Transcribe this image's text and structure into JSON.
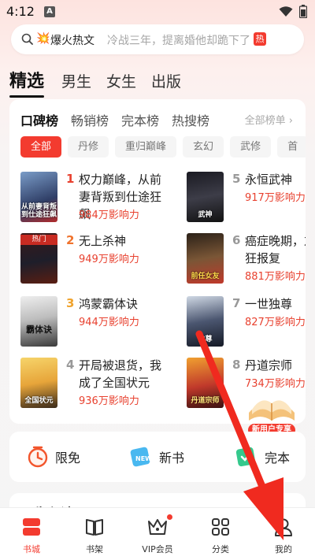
{
  "status": {
    "time": "4:12",
    "indicator": "A"
  },
  "search": {
    "hot_label": "爆火热文",
    "placeholder_text": "冷战三年，提离婚他却跪下了",
    "hot_badge": "热"
  },
  "top_tabs": [
    {
      "label": "精选",
      "active": true
    },
    {
      "label": "男生",
      "active": false
    },
    {
      "label": "女生",
      "active": false
    },
    {
      "label": "出版",
      "active": false
    }
  ],
  "rank": {
    "tabs": [
      {
        "label": "口碑榜",
        "active": true
      },
      {
        "label": "畅销榜",
        "active": false
      },
      {
        "label": "完本榜",
        "active": false
      },
      {
        "label": "热搜榜",
        "active": false
      }
    ],
    "all_label": "全部榜单 ›",
    "chips": [
      "全部",
      "丹修",
      "重归巅峰",
      "玄幻",
      "武修",
      "首"
    ],
    "books": [
      {
        "num": "1",
        "title": "权力巅峰，从前妻背叛到仕途狂飙",
        "heat": "984万影响力",
        "cover_text": "从前妻背叛到仕途狂飙",
        "color": "#e8412f"
      },
      {
        "num": "2",
        "title": "无上杀神",
        "heat": "949万影响力",
        "cover_text": "热门",
        "color": "#f0732d"
      },
      {
        "num": "3",
        "title": "鸿蒙霸体诀",
        "heat": "944万影响力",
        "cover_text": "霸体诀",
        "color": "#f0a32d"
      },
      {
        "num": "4",
        "title": "开局被退货，我成了全国状元",
        "heat": "936万影响力",
        "cover_text": "全国状元",
        "color": "#999999"
      },
      {
        "num": "5",
        "title": "永恒武神",
        "heat": "917万影响力",
        "cover_text": "武神",
        "color": "#999999"
      },
      {
        "num": "6",
        "title": "癌症晚期，友疯狂报复",
        "heat": "881万影响力",
        "cover_text": "前任女友",
        "color": "#999999"
      },
      {
        "num": "7",
        "title": "一世独尊",
        "heat": "827万影响力",
        "cover_text": "独尊",
        "color": "#999999"
      },
      {
        "num": "8",
        "title": "丹道宗师",
        "heat": "734万影响力",
        "cover_text": "丹道宗师",
        "color": "#999999"
      }
    ],
    "new_user_label": "新用户专享"
  },
  "shortcuts": [
    {
      "label": "限免",
      "icon": "clock-icon"
    },
    {
      "label": "新书",
      "icon": "new-book-icon"
    },
    {
      "label": "完本",
      "icon": "check-book-icon"
    }
  ],
  "next_section_title": "男生必读",
  "nav": [
    {
      "label": "书城",
      "icon": "bookstore-icon",
      "active": true
    },
    {
      "label": "书架",
      "icon": "bookshelf-icon",
      "active": false
    },
    {
      "label": "VIP会员",
      "icon": "crown-icon",
      "active": false
    },
    {
      "label": "分类",
      "icon": "category-icon",
      "active": false
    },
    {
      "label": "我的",
      "icon": "profile-icon",
      "active": false
    }
  ],
  "colors": {
    "accent": "#f33b2f",
    "heat": "#e8412f"
  }
}
